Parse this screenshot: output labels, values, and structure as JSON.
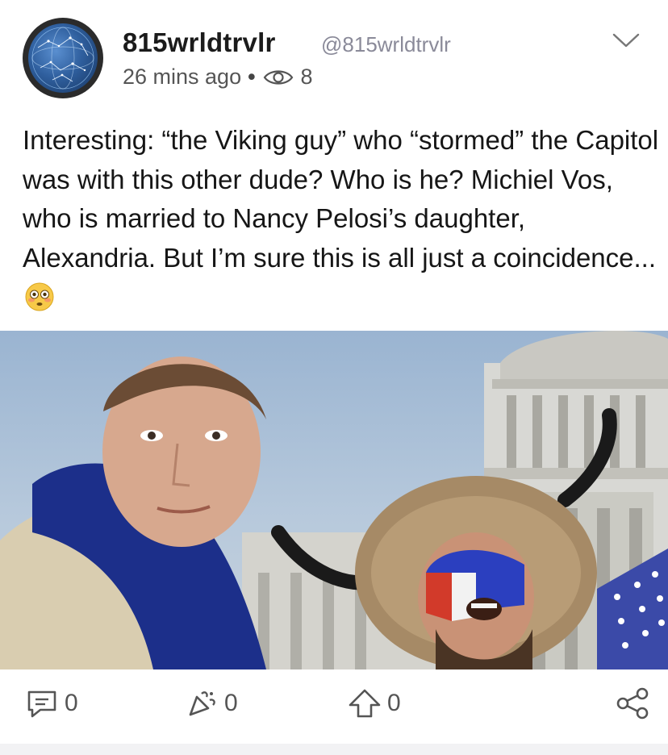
{
  "post": {
    "author": {
      "display_name": "815wrldtrvlr",
      "handle": "@815wrldtrvlr",
      "avatar_icon": "constellation-globe-avatar"
    },
    "timestamp": "26 mins ago",
    "separator": "•",
    "views": "8",
    "body": "Interesting:  “the Viking guy” who “stormed” the Capitol was with this other dude?  Who is he? Michiel Vos, who is married to Nancy Pelosi’s daughter, Alexandria.  But I’m sure this is all just a coincidence...",
    "body_emoji": "flushed-face-emoji",
    "image_description_icon": "photo"
  },
  "actions": {
    "comments": "0",
    "likes": "0",
    "upvotes": "0"
  },
  "colors": {
    "text": "#161616",
    "muted": "#555555",
    "handle": "#8a8a99"
  }
}
